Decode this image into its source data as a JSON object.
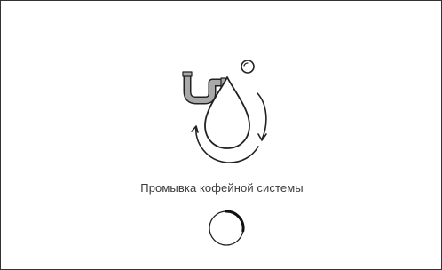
{
  "screen": {
    "status_text": "Промывка кофейной системы",
    "accent_color": "#111111",
    "line_color": "#222222",
    "pipe_color": "#a9a9a9"
  },
  "illustration": {
    "icons": [
      "pipe-icon",
      "water-drop-icon",
      "circular-arrows-icon",
      "bubble-icon"
    ]
  },
  "progress": {
    "type": "spinner"
  }
}
